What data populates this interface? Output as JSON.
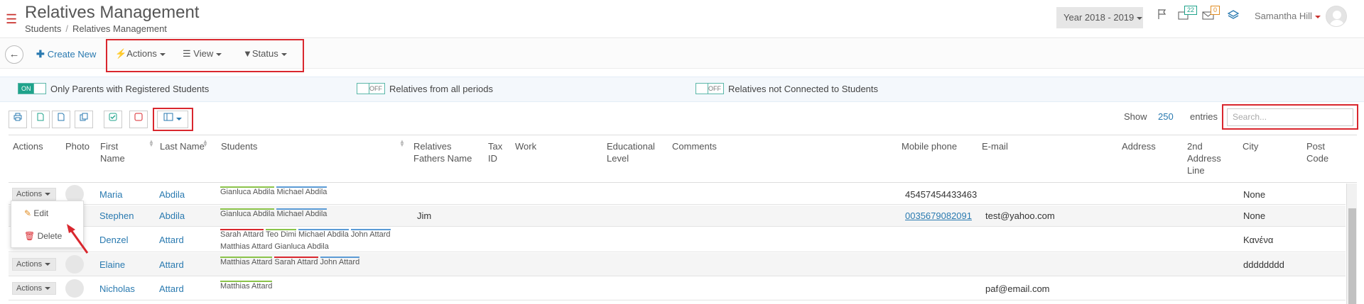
{
  "header": {
    "title": "Relatives Management",
    "breadcrumb": [
      "Students",
      "Relatives Management"
    ],
    "year_selector": "Year 2018 - 2019",
    "notif_badge_green": "22",
    "notif_badge_orange": "0",
    "user_name": "Samantha Hill"
  },
  "toolbar": {
    "create_new": "Create New",
    "menus": [
      "Actions",
      "View",
      "Status"
    ]
  },
  "filters": [
    {
      "state": "ON",
      "label": "Only Parents with Registered Students"
    },
    {
      "state": "OFF",
      "label": "Relatives from all periods"
    },
    {
      "state": "OFF",
      "label": "Relatives not Connected to Students"
    }
  ],
  "table_controls": {
    "show_label": "Show",
    "entries_count": "250",
    "entries_label": "entries",
    "search_placeholder": "Search..."
  },
  "columns": [
    "Actions",
    "Photo",
    "First Name",
    "Last Name",
    "Students",
    "Relatives Fathers Name",
    "Tax ID",
    "Work",
    "Educational Level",
    "Comments",
    "Mobile phone",
    "E-mail",
    "Address",
    "2nd Address Line",
    "City",
    "Post Code"
  ],
  "action_button": "Actions",
  "action_menu": {
    "edit": "Edit",
    "delete": "Delete"
  },
  "rows": [
    {
      "first": "Maria",
      "last": "Abdila",
      "students": [
        "Gianluca Abdila",
        "Michael Abdila"
      ],
      "father": "",
      "mobile": "45457454433463",
      "email": "",
      "city": "None"
    },
    {
      "first": "Stephen",
      "last": "Abdila",
      "students": [
        "Gianluca Abdila",
        "Michael Abdila"
      ],
      "father": "Jim",
      "mobile": "0035679082091",
      "email": "test@yahoo.com",
      "city": "None"
    },
    {
      "first": "Denzel",
      "last": "Attard",
      "students": [
        "Sarah Attard",
        "Teo Dimi",
        "Michael Abdila",
        "John Attard",
        "Matthias Attard",
        "Gianluca Abdila"
      ],
      "father": "",
      "mobile": "",
      "email": "",
      "city": "Κανένα"
    },
    {
      "first": "Elaine",
      "last": "Attard",
      "students": [
        "Matthias Attard",
        "Sarah Attard",
        "John Attard"
      ],
      "father": "",
      "mobile": "",
      "email": "",
      "city": "dddddddd"
    },
    {
      "first": "Nicholas",
      "last": "Attard",
      "students": [
        "Matthias Attard"
      ],
      "father": "",
      "mobile": "",
      "email": "paf@email.com",
      "city": ""
    }
  ],
  "colors": {
    "accent": "#2a7ab0",
    "highlight": "#d9272e",
    "toggle_on": "#1fa38b"
  }
}
